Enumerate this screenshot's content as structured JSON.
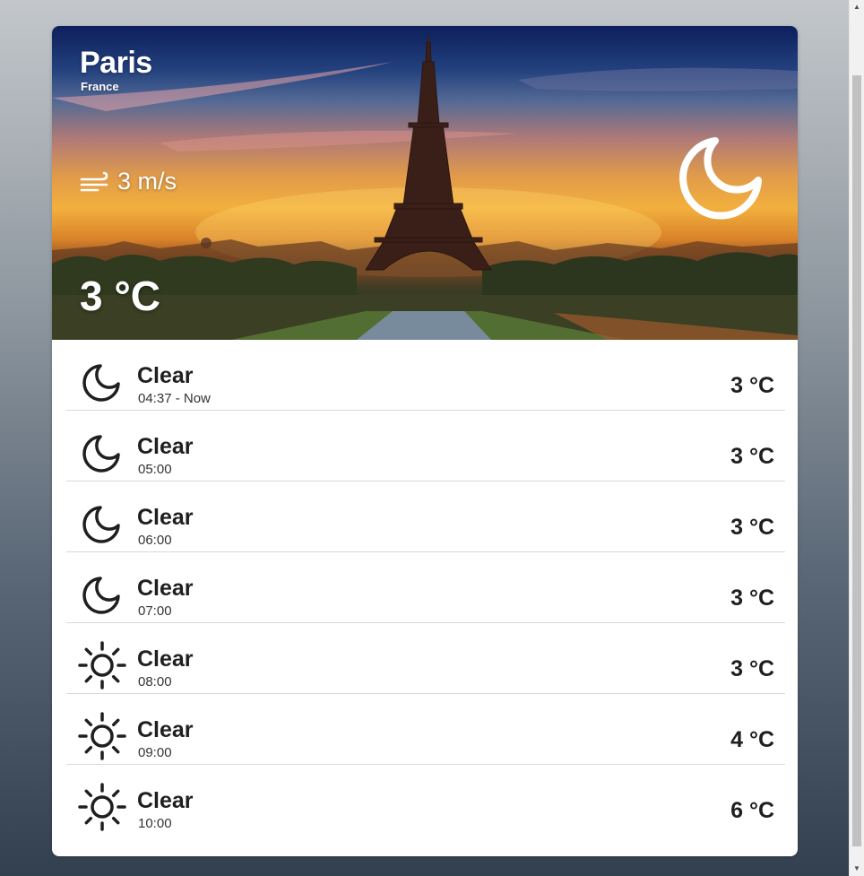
{
  "location": {
    "city": "Paris",
    "country": "France"
  },
  "current": {
    "wind": "3 m/s",
    "wind_icon": "wind-icon",
    "temperature": "3 °C",
    "condition_icon": "moon-icon"
  },
  "forecast": [
    {
      "condition": "Clear",
      "time": "04:37 - Now",
      "temp": "3 °C",
      "icon": "moon-icon"
    },
    {
      "condition": "Clear",
      "time": "05:00",
      "temp": "3 °C",
      "icon": "moon-icon"
    },
    {
      "condition": "Clear",
      "time": "06:00",
      "temp": "3 °C",
      "icon": "moon-icon"
    },
    {
      "condition": "Clear",
      "time": "07:00",
      "temp": "3 °C",
      "icon": "moon-icon"
    },
    {
      "condition": "Clear",
      "time": "08:00",
      "temp": "3 °C",
      "icon": "sun-icon"
    },
    {
      "condition": "Clear",
      "time": "09:00",
      "temp": "4 °C",
      "icon": "sun-icon"
    },
    {
      "condition": "Clear",
      "time": "10:00",
      "temp": "6 °C",
      "icon": "sun-icon"
    }
  ],
  "colors": {
    "card_background": "#ffffff",
    "text_primary": "#1f1f1f",
    "divider": "#d8d8d8"
  }
}
